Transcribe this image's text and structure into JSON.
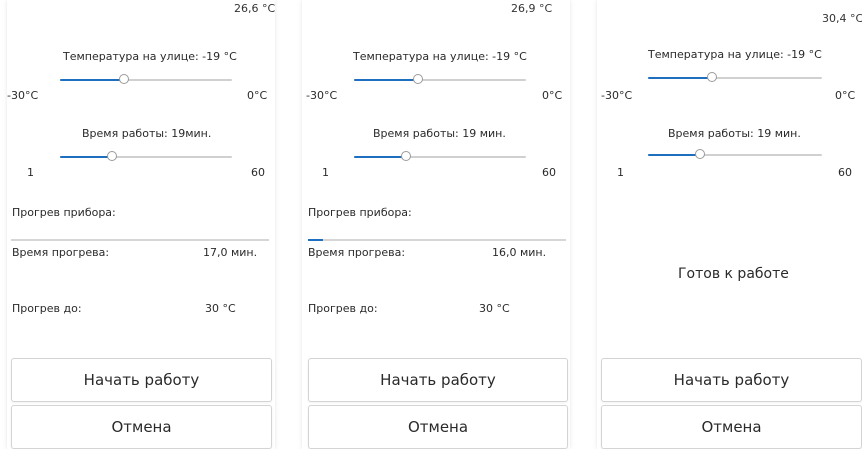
{
  "colors": {
    "accent": "#1f6fc0",
    "track": "#d0d0d0",
    "text": "#2a2a2a"
  },
  "panels": [
    {
      "current_temp": "26,6 °C",
      "outdoor_temp_label": "Температура на улице: -19 °C",
      "outdoor_min": "-30°C",
      "outdoor_max": "0°C",
      "outdoor_slider_level": 0.37,
      "work_time_label": "Время работы: 19мин.",
      "work_min": "1",
      "work_max": "60",
      "work_slider_level": 0.3,
      "warmup_label": "Прогрев прибора:",
      "warmup_progress": 0.0,
      "warmup_time_label": "Время прогрева:",
      "warmup_time_value": "17,0 мин.",
      "warmup_to_label": "Прогрев до:",
      "warmup_to_value": "30 °C",
      "start_button": "Начать работу",
      "cancel_button": "Отмена"
    },
    {
      "current_temp": "26,9 °C",
      "outdoor_temp_label": "Температура на улице: -19 °C",
      "outdoor_min": "-30°C",
      "outdoor_max": "0°C",
      "outdoor_slider_level": 0.37,
      "work_time_label": "Время работы: 19 мин.",
      "work_min": "1",
      "work_max": "60",
      "work_slider_level": 0.3,
      "warmup_label": "Прогрев прибора:",
      "warmup_progress": 0.06,
      "warmup_time_label": "Время прогрева:",
      "warmup_time_value": "16,0 мин.",
      "warmup_to_label": "Прогрев до:",
      "warmup_to_value": "30 °C",
      "start_button": "Начать работу",
      "cancel_button": "Отмена"
    },
    {
      "current_temp": "30,4 °C",
      "outdoor_temp_label": "Температура на улице: -19 °C",
      "outdoor_min": "-30°C",
      "outdoor_max": "0°C",
      "outdoor_slider_level": 0.37,
      "work_time_label": "Время работы: 19 мин.",
      "work_min": "1",
      "work_max": "60",
      "work_slider_level": 0.3,
      "ready_label": "Готов к работе",
      "start_button": "Начать работу",
      "cancel_button": "Отмена"
    }
  ]
}
